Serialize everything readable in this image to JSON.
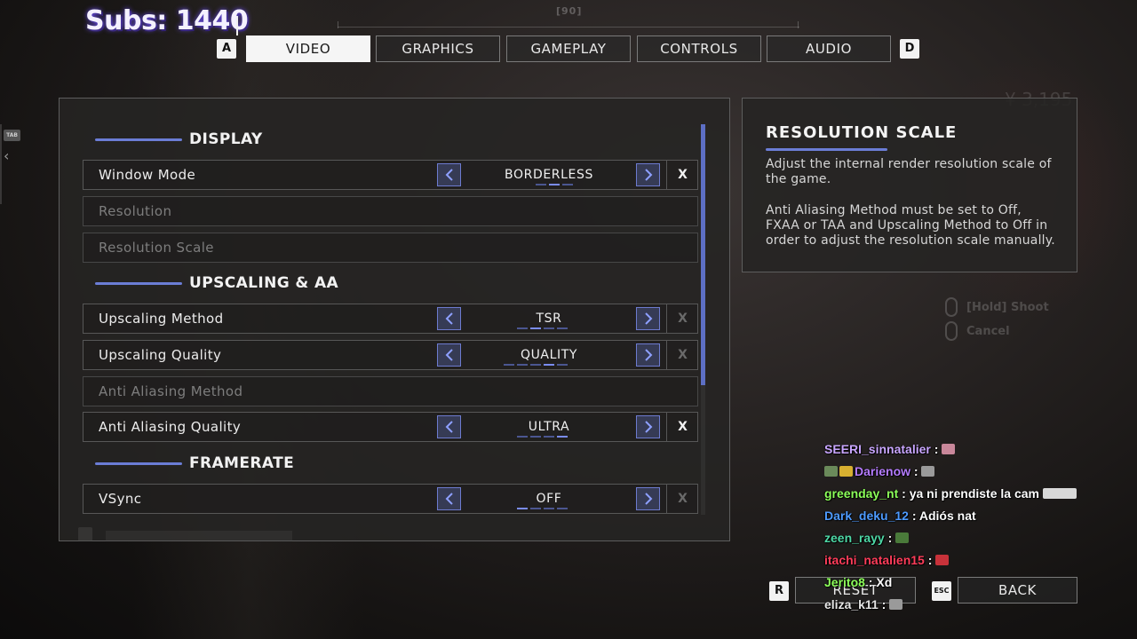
{
  "hud": {
    "subs_text": "Subs: 1440",
    "compass_value": "[90]",
    "money": "¥ 3,195",
    "side_tab_key": "TAB"
  },
  "tabs": {
    "prev_key": "A",
    "next_key": "D",
    "items": [
      {
        "label": "VIDEO",
        "active": true
      },
      {
        "label": "GRAPHICS",
        "active": false
      },
      {
        "label": "GAMEPLAY",
        "active": false
      },
      {
        "label": "CONTROLS",
        "active": false
      },
      {
        "label": "AUDIO",
        "active": false
      }
    ]
  },
  "sections": {
    "display": "DISPLAY",
    "upscaling": "UPSCALING & AA",
    "framerate": "FRAMERATE"
  },
  "settings": {
    "window_mode": {
      "label": "Window Mode",
      "value": "BORDERLESS",
      "selected_index": 1,
      "option_count": 3,
      "reset": "X",
      "reset_enabled": true
    },
    "resolution": {
      "label": "Resolution",
      "disabled": true
    },
    "resolution_scale": {
      "label": "Resolution Scale",
      "disabled": true
    },
    "upscaling_method": {
      "label": "Upscaling Method",
      "value": "TSR",
      "selected_index": 1,
      "option_count": 4,
      "reset": "X",
      "reset_enabled": false
    },
    "upscaling_quality": {
      "label": "Upscaling Quality",
      "value": "QUALITY",
      "selected_index": 3,
      "option_count": 5,
      "reset": "X",
      "reset_enabled": false
    },
    "anti_aliasing_method": {
      "label": "Anti Aliasing Method",
      "disabled": true
    },
    "anti_aliasing_quality": {
      "label": "Anti Aliasing Quality",
      "value": "ULTRA",
      "selected_index": 3,
      "option_count": 4,
      "reset": "X",
      "reset_enabled": true
    },
    "vsync": {
      "label": "VSync",
      "value": "OFF",
      "selected_index": 0,
      "option_count": 4,
      "reset": "X",
      "reset_enabled": false
    }
  },
  "description": {
    "title": "RESOLUTION SCALE",
    "paragraph1": "Adjust the internal render resolution scale of the game.",
    "paragraph2": "Anti Aliasing Method must be set to Off, FXAA or TAA and Upscaling Method to Off in order to adjust the resolution scale manually."
  },
  "control_hints": {
    "shoot": "[Hold] Shoot",
    "cancel": "Cancel"
  },
  "chat": [
    {
      "user": "SEERI_sinnatalier",
      "message": "",
      "color": "#c9a6ff",
      "badges": 0,
      "emote": "#c9879a"
    },
    {
      "user": "Darienow",
      "message": "",
      "color": "#b57cff",
      "badges": 2,
      "emote": "#9a9a9a"
    },
    {
      "user": "greenday_nt",
      "message": "ya ni prendiste la cam",
      "color": "#8cff5a",
      "badges": 0,
      "emote": "#d8d8d8"
    },
    {
      "user": "Dark_deku_12",
      "message": "Adiós nat",
      "color": "#4e9bff",
      "badges": 0,
      "emote": ""
    },
    {
      "user": "zeen_rayy",
      "message": "",
      "color": "#4ed8a6",
      "badges": 0,
      "emote": "#4a7a3a"
    },
    {
      "user": "itachi_natalien15",
      "message": "",
      "color": "#ff3d5a",
      "badges": 0,
      "emote": "#c8323a"
    },
    {
      "user": "Jerito8",
      "message": "Xd",
      "color": "#8cff5a",
      "badges": 0,
      "emote": ""
    },
    {
      "user": "eliza_k11",
      "message": "",
      "color": "#e6e6e6",
      "badges": 0,
      "emote": "#9a9a9a"
    }
  ],
  "bottom": {
    "reset_key": "R",
    "reset_label": "RESET",
    "back_key": "ESC",
    "back_label": "BACK"
  },
  "colors": {
    "accent": "#6b7dd6",
    "active_tab_bg": "#f5f5f5"
  }
}
